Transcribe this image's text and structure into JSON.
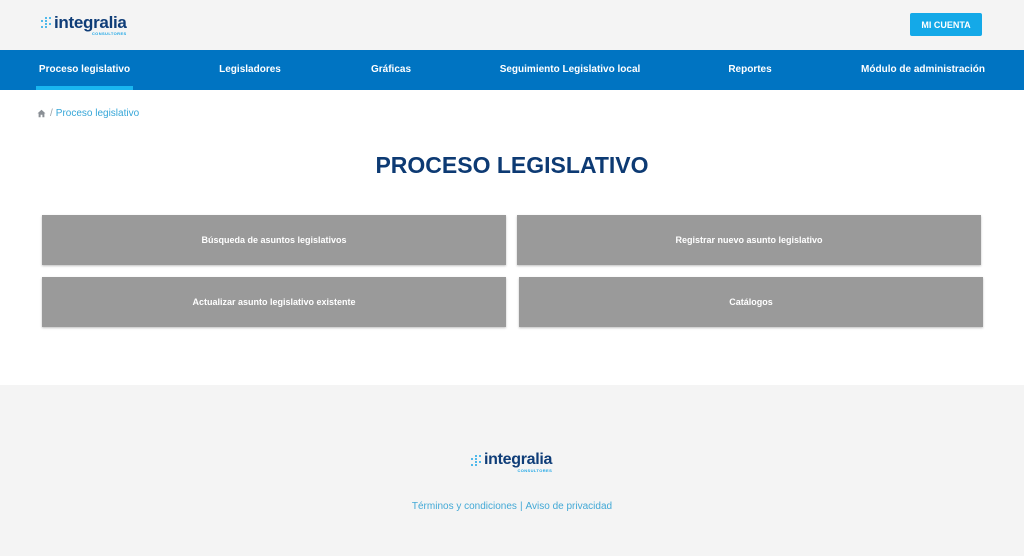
{
  "header": {
    "logo": {
      "brand": "integralia",
      "tagline": "CONSULTORES"
    },
    "account_button": "MI CUENTA"
  },
  "nav": {
    "items": [
      {
        "label": "Proceso legislativo",
        "active": true
      },
      {
        "label": "Legisladores"
      },
      {
        "label": "Gráficas"
      },
      {
        "label": "Seguimiento Legislativo local"
      },
      {
        "label": "Reportes"
      },
      {
        "label": "Módulo de administración"
      }
    ]
  },
  "breadcrumb": {
    "separator": "/",
    "current": "Proceso legislativo"
  },
  "page": {
    "title": "PROCESO LEGISLATIVO",
    "tiles": [
      {
        "label": "Búsqueda de asuntos legislativos"
      },
      {
        "label": "Registrar nuevo asunto legislativo"
      },
      {
        "label": "Actualizar asunto legislativo existente"
      },
      {
        "label": "Catálogos"
      }
    ]
  },
  "footer": {
    "logo": {
      "brand": "integralia",
      "tagline": "CONSULTORES"
    },
    "links": {
      "terms": "Términos y condiciones",
      "separator": "|",
      "privacy": "Aviso de privacidad"
    }
  },
  "colors": {
    "nav_background": "#0074c2",
    "nav_active_underline": "#19b6f0",
    "account_button": "#14a9e8",
    "title": "#0d3a73",
    "tile_background": "#9a9a9a",
    "link": "#43a9d6",
    "brand_dark": "#0f3d78",
    "brand_light": "#1ca6e6"
  }
}
